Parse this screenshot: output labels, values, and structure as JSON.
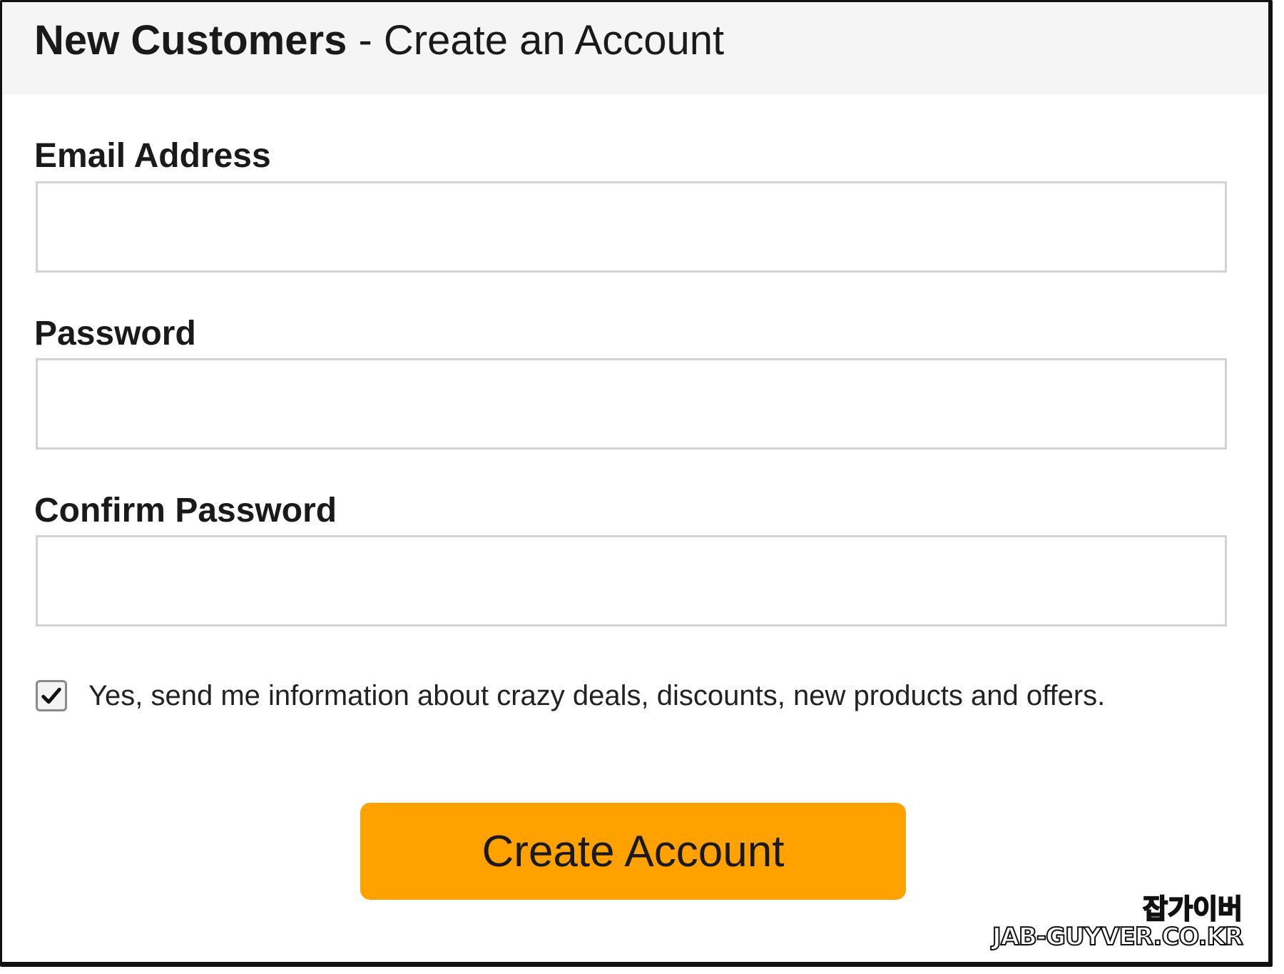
{
  "header": {
    "title_strong": "New Customers",
    "title_rest": " - Create an Account"
  },
  "form": {
    "email": {
      "label": "Email Address",
      "value": "",
      "placeholder": ""
    },
    "password": {
      "label": "Password",
      "value": "",
      "placeholder": ""
    },
    "confirm_password": {
      "label": "Confirm Password",
      "value": "",
      "placeholder": ""
    },
    "newsletter": {
      "checked": true,
      "label": "Yes, send me information about crazy deals, discounts, new products and offers."
    },
    "submit_label": "Create Account"
  },
  "watermark": {
    "korean": "잡가이버",
    "domain": "JAB-GUYVER.CO.KR"
  },
  "colors": {
    "header_bg": "#f5f5f5",
    "button_bg": "#ffa200",
    "input_border": "#d3d3d3"
  },
  "icons": {
    "checkbox": "checkmark-icon"
  }
}
